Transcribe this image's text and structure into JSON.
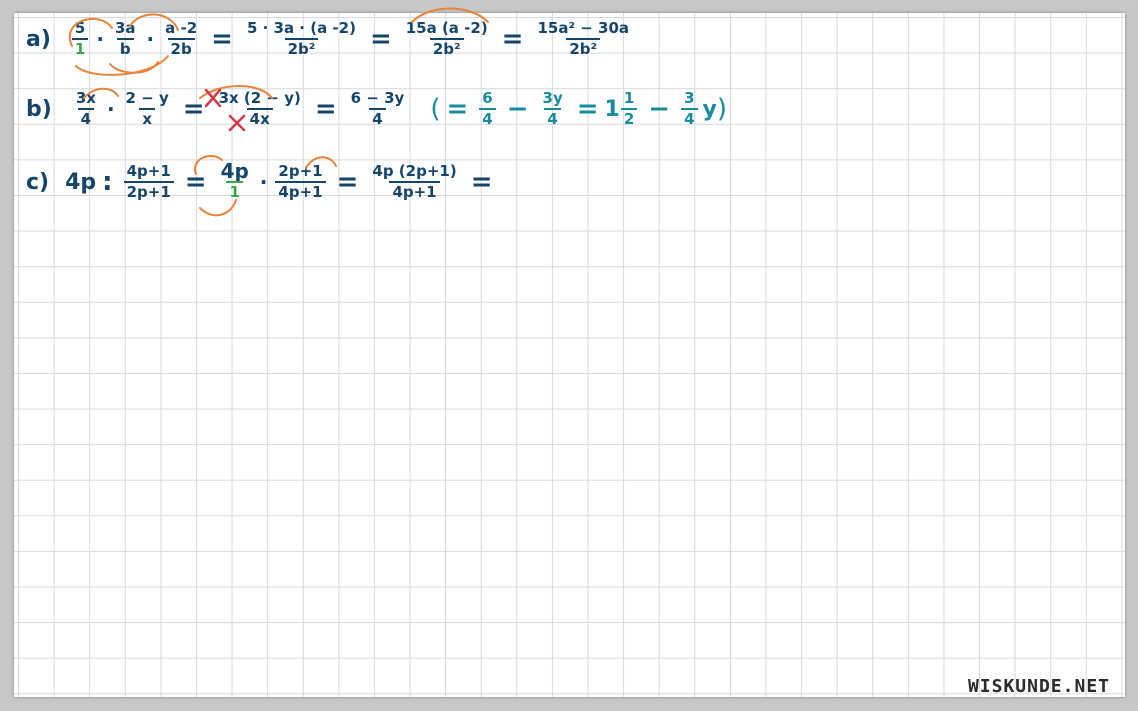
{
  "colors": {
    "ink": "#16456a",
    "teal": "#178c9e",
    "orange": "#e8843a",
    "green": "#3aa64a",
    "red": "#d23a45"
  },
  "watermark": "WISKUNDE.NET",
  "a": {
    "label": "a)",
    "f1_num": "5",
    "f1_den": "1",
    "f2_num": "3a",
    "f2_den": "b",
    "f3_num": "a -2",
    "f3_den": "2b",
    "f4_num": "5 · 3a · (a -2)",
    "f4_den": "2b²",
    "f5_num": "15a (a -2)",
    "f5_den": "2b²",
    "f6_num": "15a² − 30a",
    "f6_den": "2b²",
    "dot": "·",
    "eq": "="
  },
  "b": {
    "label": "b)",
    "f1_num": "3x",
    "f1_den": "4",
    "f2_num": "2 − y",
    "f2_den": "x",
    "f3_num": "3x (2 − y)",
    "f3_den": "4x",
    "f4_num": "6 − 3y",
    "f4_den": "4",
    "aside": {
      "open": "(",
      "eq1": "=",
      "t1_num": "6",
      "t1_den": "4",
      "minus": "−",
      "t2_num": "3y",
      "t2_den": "4",
      "eq2": "=",
      "whole": "1",
      "m_num": "1",
      "m_den": "2",
      "minus2": "−",
      "c_num": "3",
      "c_den": "4",
      "var": "y",
      "close": ")"
    },
    "dot": "·",
    "eq": "="
  },
  "c": {
    "label": "c)",
    "term": "4p",
    "colon": ":",
    "f1_num": "4p+1",
    "f1_den": "2p+1",
    "term2_num": "4p",
    "term2_den": "1",
    "f2_num": "2p+1",
    "f2_den": "4p+1",
    "f3_num": "4p (2p+1)",
    "f3_den": "4p+1",
    "dot": "·",
    "eq": "="
  }
}
